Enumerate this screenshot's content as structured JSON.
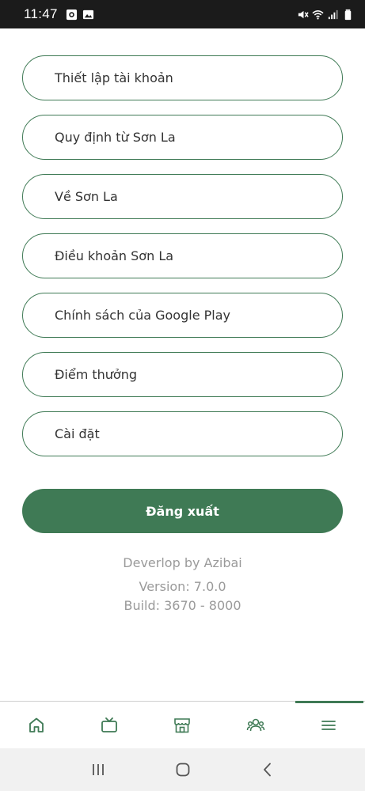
{
  "status_bar": {
    "time": "11:47",
    "left_icons": [
      "screen-record-icon",
      "image-icon"
    ],
    "right_icons": [
      "mute-icon",
      "wifi-icon",
      "signal-icon",
      "battery-icon"
    ]
  },
  "menu": {
    "items": [
      {
        "label": "Thiết lập tài khoản"
      },
      {
        "label": "Quy định từ Sơn La"
      },
      {
        "label": "Về Sơn La"
      },
      {
        "label": "Điều khoản Sơn La"
      },
      {
        "label": "Chính sách của Google Play"
      },
      {
        "label": "Điểm thưởng"
      },
      {
        "label": "Cài đặt"
      }
    ]
  },
  "logout": {
    "label": "Đăng xuất"
  },
  "info": {
    "developer": "Deverlop by Azibai",
    "version": "Version: 7.0.0",
    "build": "Build: 3670 - 8000"
  },
  "bottom_nav": {
    "items": [
      {
        "icon": "home-icon"
      },
      {
        "icon": "tv-icon"
      },
      {
        "icon": "store-icon"
      },
      {
        "icon": "community-icon"
      },
      {
        "icon": "menu-icon",
        "active": true
      }
    ]
  },
  "colors": {
    "accent": "#3f7a55",
    "status_bar": "#1b1b1b",
    "muted_text": "#9a9a9a"
  }
}
